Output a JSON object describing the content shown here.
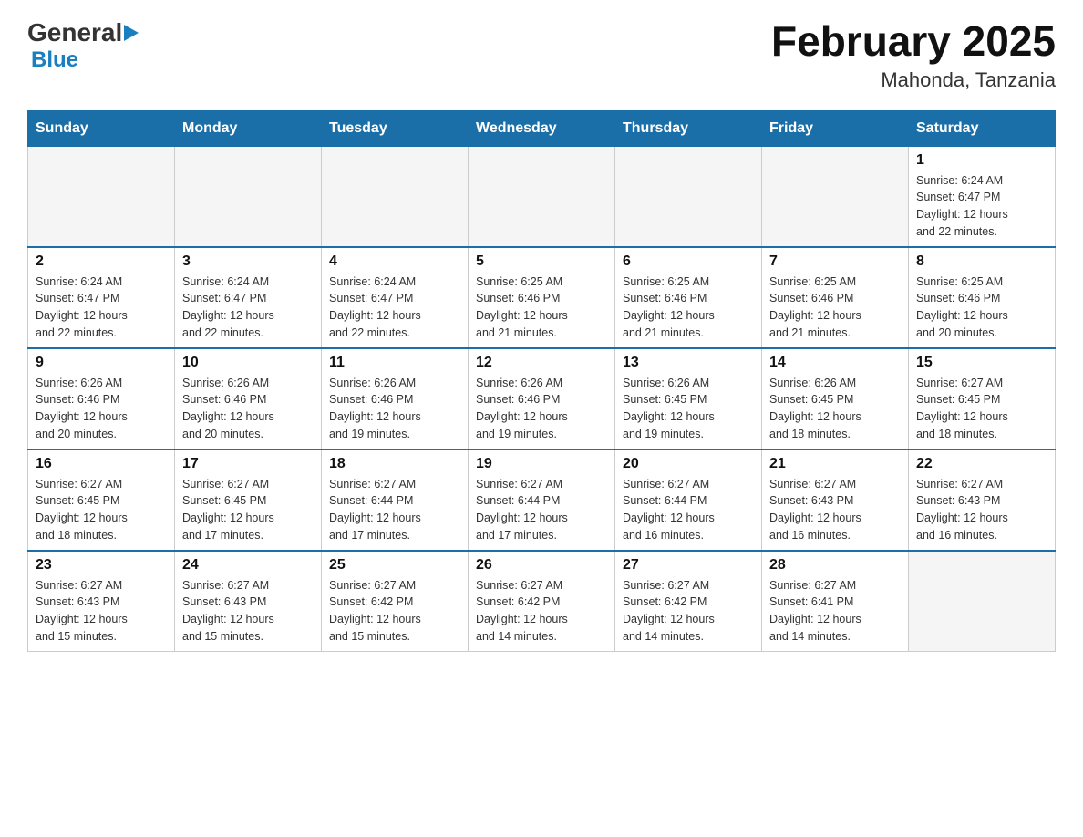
{
  "header": {
    "logo_general": "General",
    "logo_blue": "Blue",
    "title": "February 2025",
    "subtitle": "Mahonda, Tanzania"
  },
  "weekdays": [
    "Sunday",
    "Monday",
    "Tuesday",
    "Wednesday",
    "Thursday",
    "Friday",
    "Saturday"
  ],
  "weeks": [
    [
      {
        "day": "",
        "info": ""
      },
      {
        "day": "",
        "info": ""
      },
      {
        "day": "",
        "info": ""
      },
      {
        "day": "",
        "info": ""
      },
      {
        "day": "",
        "info": ""
      },
      {
        "day": "",
        "info": ""
      },
      {
        "day": "1",
        "info": "Sunrise: 6:24 AM\nSunset: 6:47 PM\nDaylight: 12 hours\nand 22 minutes."
      }
    ],
    [
      {
        "day": "2",
        "info": "Sunrise: 6:24 AM\nSunset: 6:47 PM\nDaylight: 12 hours\nand 22 minutes."
      },
      {
        "day": "3",
        "info": "Sunrise: 6:24 AM\nSunset: 6:47 PM\nDaylight: 12 hours\nand 22 minutes."
      },
      {
        "day": "4",
        "info": "Sunrise: 6:24 AM\nSunset: 6:47 PM\nDaylight: 12 hours\nand 22 minutes."
      },
      {
        "day": "5",
        "info": "Sunrise: 6:25 AM\nSunset: 6:46 PM\nDaylight: 12 hours\nand 21 minutes."
      },
      {
        "day": "6",
        "info": "Sunrise: 6:25 AM\nSunset: 6:46 PM\nDaylight: 12 hours\nand 21 minutes."
      },
      {
        "day": "7",
        "info": "Sunrise: 6:25 AM\nSunset: 6:46 PM\nDaylight: 12 hours\nand 21 minutes."
      },
      {
        "day": "8",
        "info": "Sunrise: 6:25 AM\nSunset: 6:46 PM\nDaylight: 12 hours\nand 20 minutes."
      }
    ],
    [
      {
        "day": "9",
        "info": "Sunrise: 6:26 AM\nSunset: 6:46 PM\nDaylight: 12 hours\nand 20 minutes."
      },
      {
        "day": "10",
        "info": "Sunrise: 6:26 AM\nSunset: 6:46 PM\nDaylight: 12 hours\nand 20 minutes."
      },
      {
        "day": "11",
        "info": "Sunrise: 6:26 AM\nSunset: 6:46 PM\nDaylight: 12 hours\nand 19 minutes."
      },
      {
        "day": "12",
        "info": "Sunrise: 6:26 AM\nSunset: 6:46 PM\nDaylight: 12 hours\nand 19 minutes."
      },
      {
        "day": "13",
        "info": "Sunrise: 6:26 AM\nSunset: 6:45 PM\nDaylight: 12 hours\nand 19 minutes."
      },
      {
        "day": "14",
        "info": "Sunrise: 6:26 AM\nSunset: 6:45 PM\nDaylight: 12 hours\nand 18 minutes."
      },
      {
        "day": "15",
        "info": "Sunrise: 6:27 AM\nSunset: 6:45 PM\nDaylight: 12 hours\nand 18 minutes."
      }
    ],
    [
      {
        "day": "16",
        "info": "Sunrise: 6:27 AM\nSunset: 6:45 PM\nDaylight: 12 hours\nand 18 minutes."
      },
      {
        "day": "17",
        "info": "Sunrise: 6:27 AM\nSunset: 6:45 PM\nDaylight: 12 hours\nand 17 minutes."
      },
      {
        "day": "18",
        "info": "Sunrise: 6:27 AM\nSunset: 6:44 PM\nDaylight: 12 hours\nand 17 minutes."
      },
      {
        "day": "19",
        "info": "Sunrise: 6:27 AM\nSunset: 6:44 PM\nDaylight: 12 hours\nand 17 minutes."
      },
      {
        "day": "20",
        "info": "Sunrise: 6:27 AM\nSunset: 6:44 PM\nDaylight: 12 hours\nand 16 minutes."
      },
      {
        "day": "21",
        "info": "Sunrise: 6:27 AM\nSunset: 6:43 PM\nDaylight: 12 hours\nand 16 minutes."
      },
      {
        "day": "22",
        "info": "Sunrise: 6:27 AM\nSunset: 6:43 PM\nDaylight: 12 hours\nand 16 minutes."
      }
    ],
    [
      {
        "day": "23",
        "info": "Sunrise: 6:27 AM\nSunset: 6:43 PM\nDaylight: 12 hours\nand 15 minutes."
      },
      {
        "day": "24",
        "info": "Sunrise: 6:27 AM\nSunset: 6:43 PM\nDaylight: 12 hours\nand 15 minutes."
      },
      {
        "day": "25",
        "info": "Sunrise: 6:27 AM\nSunset: 6:42 PM\nDaylight: 12 hours\nand 15 minutes."
      },
      {
        "day": "26",
        "info": "Sunrise: 6:27 AM\nSunset: 6:42 PM\nDaylight: 12 hours\nand 14 minutes."
      },
      {
        "day": "27",
        "info": "Sunrise: 6:27 AM\nSunset: 6:42 PM\nDaylight: 12 hours\nand 14 minutes."
      },
      {
        "day": "28",
        "info": "Sunrise: 6:27 AM\nSunset: 6:41 PM\nDaylight: 12 hours\nand 14 minutes."
      },
      {
        "day": "",
        "info": ""
      }
    ]
  ]
}
